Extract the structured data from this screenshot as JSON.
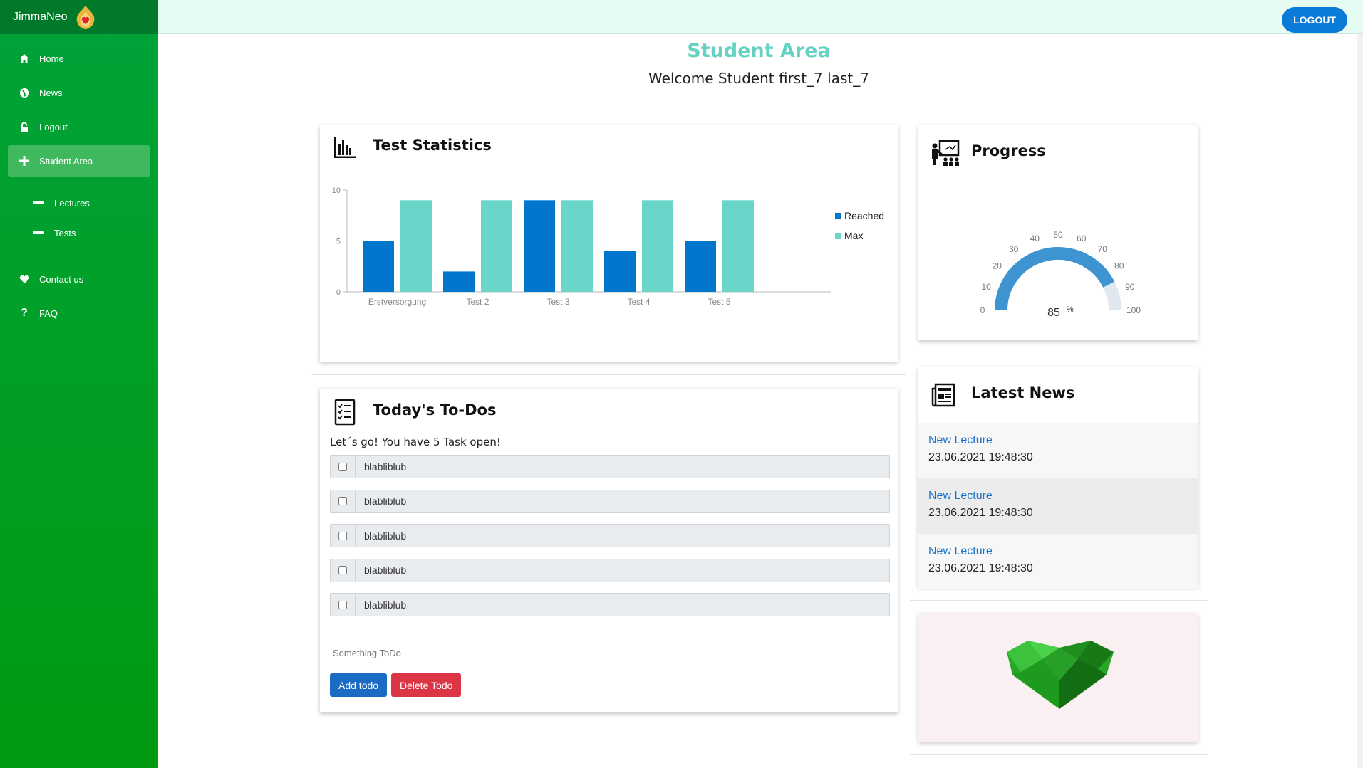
{
  "brand": {
    "name": "JimmaNeo"
  },
  "sidebar": {
    "items": [
      {
        "label": "Home",
        "icon": "home-icon"
      },
      {
        "label": "News",
        "icon": "globe-icon"
      },
      {
        "label": "Logout",
        "icon": "lock-icon"
      },
      {
        "label": "Student Area",
        "icon": "plus-icon",
        "active": true
      }
    ],
    "sub_items": [
      {
        "label": "Lectures"
      },
      {
        "label": "Tests"
      }
    ],
    "bottom_items": [
      {
        "label": "Contact us",
        "icon": "heart-icon"
      },
      {
        "label": "FAQ",
        "icon": "question-icon"
      }
    ]
  },
  "topbar": {
    "logout_label": "LOGOUT"
  },
  "header": {
    "title": "Student Area",
    "welcome": "Welcome Student first_7 last_7"
  },
  "colors": {
    "sidebar": "#009a10",
    "accent": "#66d2c3",
    "reached": "#0077cc",
    "max": "#6ad6c9",
    "button": "#0a7bd6"
  },
  "test_statistics": {
    "title": "Test Statistics",
    "chart_data": {
      "type": "bar",
      "categories": [
        "Erstversorgung",
        "Test 2",
        "Test 3",
        "Test 4",
        "Test 5"
      ],
      "series": [
        {
          "name": "Reached",
          "values": [
            5,
            2,
            9,
            4,
            5
          ]
        },
        {
          "name": "Max",
          "values": [
            9,
            9,
            9,
            9,
            9
          ]
        }
      ],
      "ylim": [
        0,
        10
      ],
      "yticks": [
        0,
        5,
        10
      ],
      "legend": "right"
    }
  },
  "progress": {
    "title": "Progress",
    "value": 85,
    "unit": "%",
    "ticks": [
      "0",
      "10",
      "20",
      "30",
      "40",
      "50",
      "60",
      "70",
      "80",
      "90",
      "100"
    ]
  },
  "todos": {
    "title": "Today's To-Dos",
    "intro": "Let´s go! You have 5 Task open!",
    "items": [
      "blabliblub",
      "blabliblub",
      "blabliblub",
      "blabliblub",
      "blabliblub"
    ],
    "input_placeholder": "Something ToDo",
    "add_label": "Add todo",
    "delete_label": "Delete Todo"
  },
  "news": {
    "title": "Latest News",
    "items": [
      {
        "title": "New Lecture",
        "date": "23.06.2021 19:48:30"
      },
      {
        "title": "New Lecture",
        "date": "23.06.2021 19:48:30"
      },
      {
        "title": "New Lecture",
        "date": "23.06.2021 19:48:30"
      }
    ]
  }
}
